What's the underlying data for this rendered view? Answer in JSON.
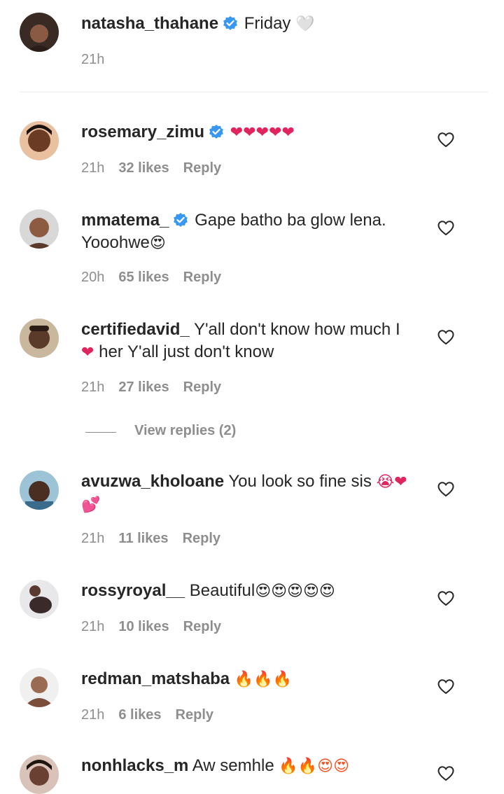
{
  "caption": {
    "username": "natasha_thahane",
    "text": "Friday",
    "emoji": "🤍",
    "time": "21h"
  },
  "comments": [
    {
      "username": "rosemary_zimu",
      "verified": true,
      "text": "",
      "emoji": "❤❤❤❤❤",
      "time": "21h",
      "likes": "32 likes",
      "reply": "Reply"
    },
    {
      "username": "mmatema_",
      "verified": true,
      "text": "Gape batho ba glow lena.",
      "text2": "Yooohwe",
      "emoji": "😍",
      "time": "20h",
      "likes": "65 likes",
      "reply": "Reply"
    },
    {
      "username": "certifiedavid_",
      "verified": false,
      "text": "Y'all don't know how much I",
      "text2": "her Y'all just don't know",
      "emoji": "❤",
      "time": "21h",
      "likes": "27 likes",
      "reply": "Reply",
      "view_replies": "View replies (2)"
    },
    {
      "username": "avuzwa_kholoane",
      "verified": false,
      "text": "You look so fine sis",
      "emoji": "😭❤",
      "emoji2": "💕",
      "time": "21h",
      "likes": "11 likes",
      "reply": "Reply"
    },
    {
      "username": "rossyroyal__",
      "verified": false,
      "text": "Beautiful",
      "emoji": "😍😍😍😍😍",
      "time": "21h",
      "likes": "10 likes",
      "reply": "Reply"
    },
    {
      "username": "redman_matshaba",
      "verified": false,
      "text": "",
      "emoji": "🔥🔥🔥",
      "time": "21h",
      "likes": "6 likes",
      "reply": "Reply"
    },
    {
      "username": "nonhlacks_m",
      "verified": false,
      "text": "Aw semhle",
      "emoji": "🔥🔥😍😍",
      "time": "",
      "likes": "",
      "reply": ""
    }
  ],
  "colors": {
    "verified": "#3897f0",
    "meta": "#8e8e8e",
    "text": "#262626",
    "heart": "#e0245e"
  },
  "icons": {
    "like": "heart-outline-icon",
    "verified": "verified-badge-icon"
  }
}
